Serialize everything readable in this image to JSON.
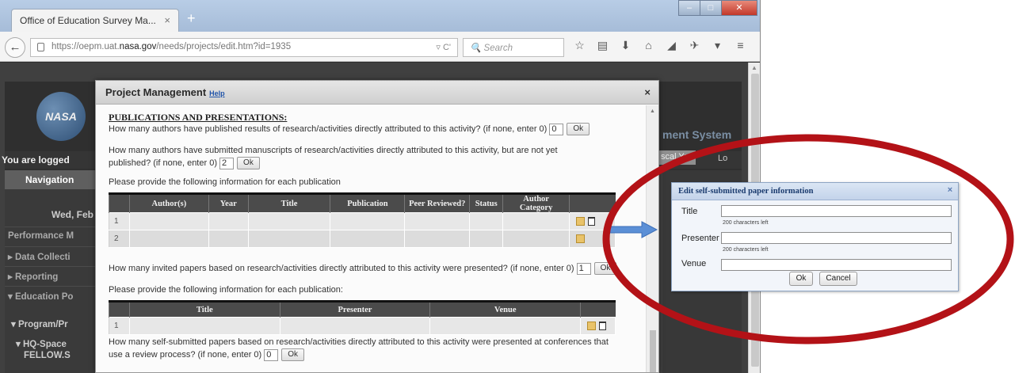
{
  "browser": {
    "tab_title": "Office of Education Survey Ma...",
    "tab_close": "×",
    "new_tab": "+",
    "window_controls": {
      "minimize": "–",
      "maximize": "□",
      "close": "✕"
    },
    "url_prefix": "https://oepm.uat.",
    "url_host": "nasa.gov",
    "url_path": "/needs/projects/edit.htm?id=1935",
    "url_tools": "▿  C'",
    "search_placeholder": "Search",
    "back_glyph": "←",
    "nav_icons": [
      "☆",
      "▤",
      "⬇",
      "⌂",
      "◢",
      "✈",
      "▾",
      "≡"
    ]
  },
  "page": {
    "logo_text": "NASA",
    "system_text": "ment System",
    "logged_in_text": "You are logged",
    "fiscal_year_btn": "scal Year",
    "logout_link": "Lo",
    "nav_header": "Navigation",
    "date_text": "Wed, Feb",
    "sidebar_items": [
      "Performance M",
      "▸ Data Collecti",
      "▸ Reporting",
      "▾ Education Po"
    ],
    "sidebar_sub": [
      "▾ Program/Pr",
      "▾ HQ-Space",
      "FELLOW.S"
    ]
  },
  "modal": {
    "title": "Project Management",
    "help_link": "Help",
    "close": "×",
    "section_title": "PUBLICATIONS AND PRESENTATIONS:",
    "q1_text": "How many authors have published results of research/activities directly attributed to this activity? (if none, enter 0)",
    "q1_value": "0",
    "q2_text": "How many authors have submitted manuscripts of research/activities directly attributed to this activity, but are not yet published? (if none, enter 0)",
    "q2_value": "2",
    "q3_text": "Please provide the following information for each publication",
    "pub_columns": [
      "Author(s)",
      "Year",
      "Title",
      "Publication",
      "Peer Reviewed?",
      "Status",
      "Author Category"
    ],
    "pub_rows": [
      "1",
      "2"
    ],
    "q4_text": "How many invited papers based on research/activities directly attributed to this activity were presented? (if none, enter 0)",
    "q4_value": "1",
    "q5_text": "Please provide the following information for each publication:",
    "inv_columns": [
      "Title",
      "Presenter",
      "Venue"
    ],
    "inv_rows": [
      "1"
    ],
    "q6_text": "How many self-submitted papers based on research/activities directly attributed to this activity were presented at conferences that use a review process? (if none, enter 0)",
    "q6_value": "0",
    "ok_label": "Ok"
  },
  "popup": {
    "title": "Edit self-submitted paper information",
    "close": "×",
    "title_label": "Title",
    "presenter_label": "Presenter",
    "venue_label": "Venue",
    "hint": "200 characters left",
    "ok_label": "Ok",
    "cancel_label": "Cancel"
  },
  "colors": {
    "highlight_ellipse": "#b31217",
    "arrow": "#5b8fd6"
  }
}
